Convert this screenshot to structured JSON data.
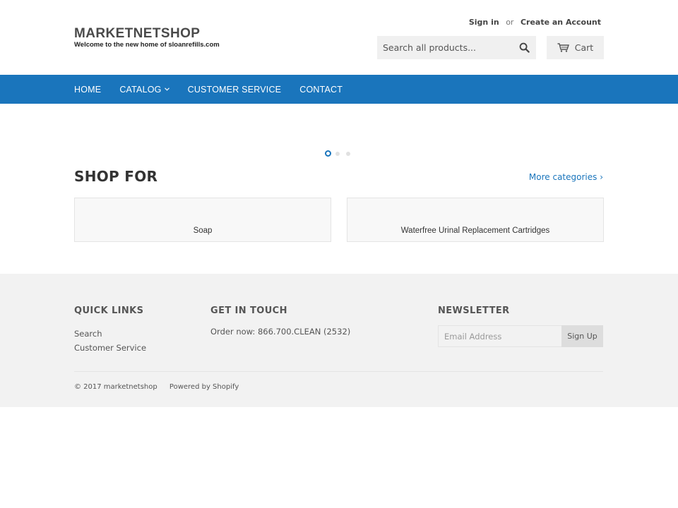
{
  "header": {
    "logo_title": "MARKETNETSHOP",
    "logo_tagline": "Welcome to the new home of sloanrefills.com",
    "sign_in": "Sign in",
    "or": "or",
    "create_account": "Create an Account",
    "search_placeholder": "Search all products...",
    "cart_label": "Cart"
  },
  "nav": {
    "items": [
      {
        "label": "HOME"
      },
      {
        "label": "CATALOG"
      },
      {
        "label": "CUSTOMER SERVICE"
      },
      {
        "label": "CONTACT"
      }
    ]
  },
  "slider": {
    "slide_count": 3,
    "active_index": 0
  },
  "shop_for": {
    "title": "SHOP FOR",
    "more_link": "More categories ›",
    "categories": [
      {
        "label": "Soap"
      },
      {
        "label": "Waterfree Urinal Replacement Cartridges"
      }
    ]
  },
  "footer": {
    "quick_links_heading": "QUICK LINKS",
    "quick_links": [
      {
        "label": "Search"
      },
      {
        "label": "Customer Service"
      }
    ],
    "get_in_touch_heading": "GET IN TOUCH",
    "contact_text": "Order now: 866.700.CLEAN (2532)",
    "newsletter_heading": "NEWSLETTER",
    "email_placeholder": "Email Address",
    "signup_label": "Sign Up",
    "copyright": "© 2017 marketnetshop",
    "powered_by": "Powered by Shopify"
  },
  "colors": {
    "brand_blue": "#1a75bc",
    "footer_bg": "#f2f2f2"
  },
  "icons": {
    "search": "search-icon",
    "cart": "cart-icon",
    "catalog_dropdown": "chevron-down-icon"
  }
}
